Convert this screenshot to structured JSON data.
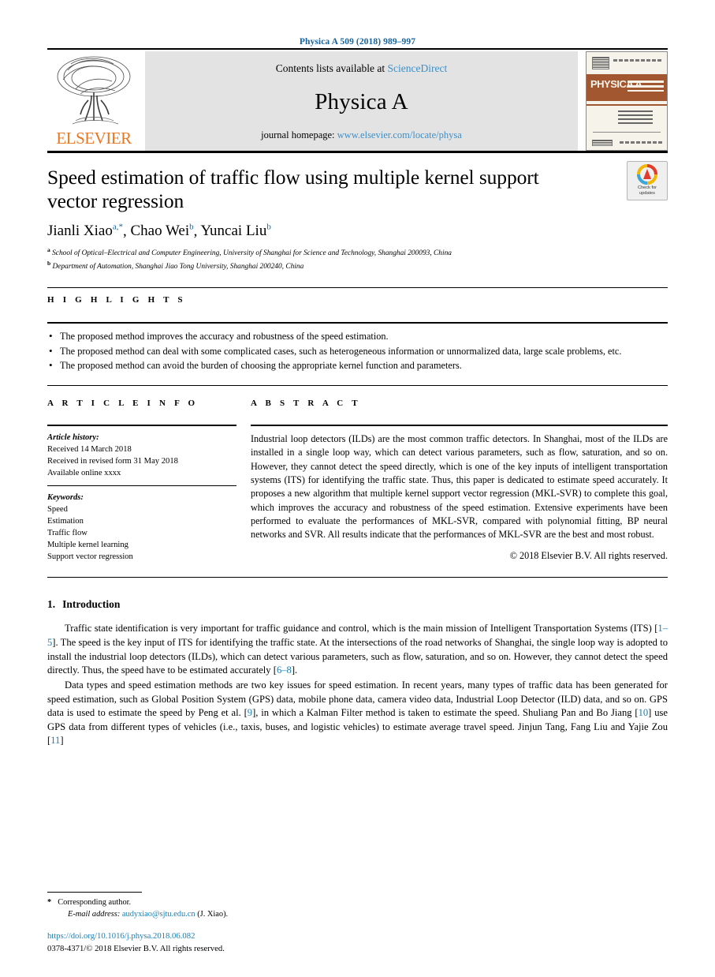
{
  "running_head": "Physica A 509 (2018) 989–997",
  "masthead": {
    "publisher_wordmark": "ELSEVIER",
    "contents_prefix": "Contents lists available at ",
    "contents_link": "ScienceDirect",
    "journal_title": "Physica A",
    "homepage_prefix": "journal homepage: ",
    "homepage_url": "www.elsevier.com/locate/physa",
    "cover_title": "PHYSICA A",
    "cover_subtitle": "STATISTICAL MECHANICS AND ITS APPLICATIONS"
  },
  "article": {
    "title": "Speed estimation of traffic flow using multiple kernel support vector regression",
    "crossmark_line1": "Check for",
    "crossmark_line2": "updates",
    "authors": [
      {
        "name": "Jianli Xiao",
        "marks": "a,*"
      },
      {
        "name": "Chao Wei",
        "marks": "b"
      },
      {
        "name": "Yuncai Liu",
        "marks": "b"
      }
    ],
    "affiliations": [
      {
        "mark": "a",
        "text": "School of Optical–Electrical and Computer Engineering, University of Shanghai for Science and Technology, Shanghai  200093, China"
      },
      {
        "mark": "b",
        "text": "Department of Automation, Shanghai Jiao Tong University, Shanghai  200240, China"
      }
    ]
  },
  "highlights": {
    "heading": "H I G H L I G H T S",
    "items": [
      "The proposed method improves the accuracy and robustness of the speed estimation.",
      "The proposed method can deal with some complicated cases, such as heterogeneous information or unnormalized data, large scale problems, etc.",
      "The proposed method can avoid the burden of choosing the appropriate kernel function and parameters."
    ]
  },
  "article_info": {
    "heading": "A R T I C L E    I N F O",
    "history_label": "Article history:",
    "history": [
      "Received 14 March 2018",
      "Received in revised form 31 May 2018",
      "Available online xxxx"
    ],
    "keywords_label": "Keywords:",
    "keywords": [
      "Speed",
      "Estimation",
      "Traffic flow",
      "Multiple kernel learning",
      "Support vector regression"
    ]
  },
  "abstract": {
    "heading": "A B S T R A C T",
    "text": "Industrial loop detectors (ILDs) are the most common traffic detectors. In Shanghai, most of the ILDs are installed in a single loop way, which can detect various parameters, such as flow, saturation, and so on. However, they cannot detect the speed directly, which is one of the key inputs of intelligent transportation systems (ITS) for identifying the traffic state. Thus, this paper is dedicated to estimate speed accurately. It proposes a new algorithm that multiple kernel support vector regression (MKL-SVR) to complete this goal, which improves the accuracy and robustness of the speed estimation. Extensive experiments have been performed to evaluate the performances of MKL-SVR, compared with polynomial fitting, BP neural networks and SVR. All results indicate that the performances of MKL-SVR are the best and most robust.",
    "copyright": "© 2018 Elsevier B.V. All rights reserved."
  },
  "introduction": {
    "number": "1.",
    "title": "Introduction",
    "paragraph1_part1": "Traffic state identification is very important for traffic guidance and control, which is the main mission of Intelligent Transportation Systems (ITS) [",
    "paragraph1_cite1": "1–5",
    "paragraph1_part2": "]. The speed is the key input of ITS for identifying the traffic state. At the intersections of the road networks of Shanghai, the single loop way is adopted to install the industrial loop detectors (ILDs), which can detect various parameters, such as flow, saturation, and so on. However, they cannot detect the speed directly. Thus, the speed have to be estimated accurately [",
    "paragraph1_cite2": "6–8",
    "paragraph1_part3": "].",
    "paragraph2_part1": "Data types and speed estimation methods are two key issues for speed estimation. In recent years, many types of traffic data has been generated for speed estimation, such as Global Position System (GPS) data, mobile phone data, camera video data, Industrial Loop Detector (ILD) data, and so on. GPS data is used to estimate the speed by Peng et al. [",
    "paragraph2_cite1": "9",
    "paragraph2_part2": "], in which a Kalman Filter method is taken to estimate the speed. Shuliang Pan and Bo Jiang [",
    "paragraph2_cite2": "10",
    "paragraph2_part3": "] use GPS data from different types of vehicles (i.e., taxis, buses, and logistic vehicles) to estimate average travel speed. Jinjun Tang, Fang Liu and Yajie Zou [",
    "paragraph2_cite3": "11",
    "paragraph2_part4": "]"
  },
  "footer": {
    "corresponding_star": "*",
    "corresponding_label": "Corresponding author.",
    "email_label": "E-mail address:",
    "email": "audyxiao@sjtu.edu.cn",
    "email_suffix": "(J. Xiao).",
    "doi": "https://doi.org/10.1016/j.physa.2018.06.082",
    "issn_line": "0378-4371/© 2018 Elsevier B.V. All rights reserved."
  },
  "colors": {
    "link_blue": "#1b7fb5",
    "header_blue": "#1464a0",
    "elsevier_orange": "#e87722",
    "banner_gray": "#e3e3e3"
  }
}
